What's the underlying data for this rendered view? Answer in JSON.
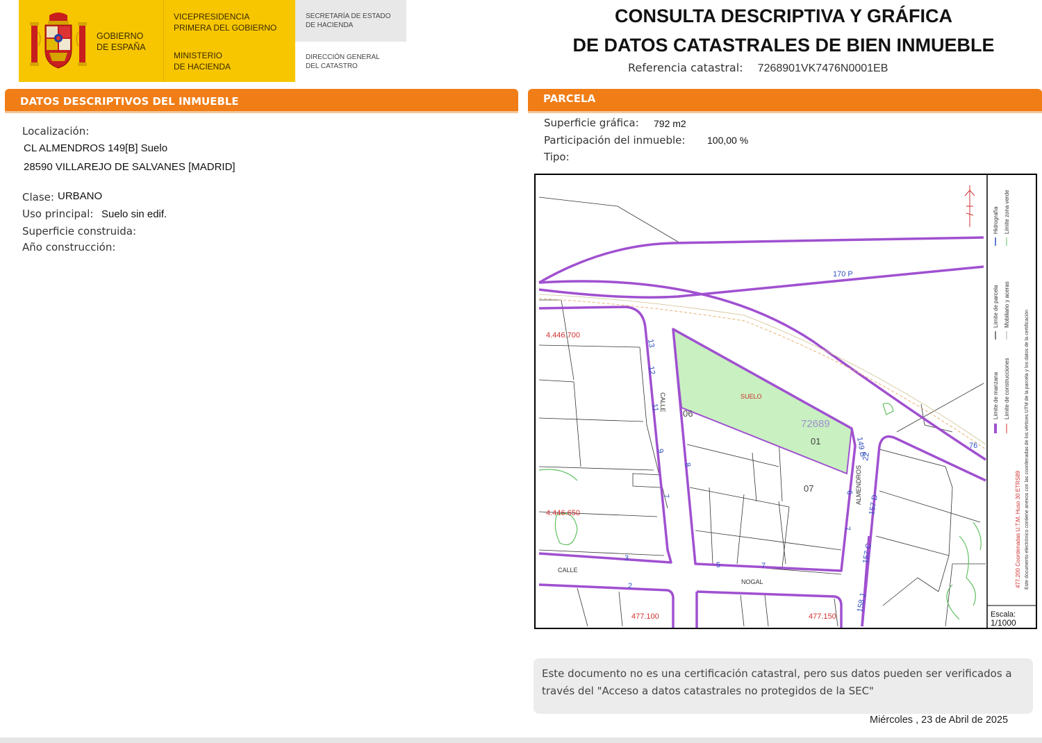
{
  "header": {
    "gov_name": [
      "GOBIERNO",
      "DE ESPAÑA"
    ],
    "vp": [
      "VICEPRESIDENCIA",
      "PRIMERA DEL GOBIERNO"
    ],
    "ministry": [
      "MINISTERIO",
      "DE HACIENDA"
    ],
    "secretaria": [
      "SECRETARÍA DE ESTADO",
      "DE HACIENDA"
    ],
    "direccion": [
      "DIRECCIÓN GENERAL",
      "DEL CATASTRO"
    ],
    "title_line1": "CONSULTA DESCRIPTIVA Y GRÁFICA",
    "title_line2": "DE DATOS CATASTRALES DE BIEN INMUEBLE",
    "ref_label": "Referencia catastral:",
    "ref_value": "7268901VK7476N0001EB"
  },
  "left": {
    "section_title": "DATOS DESCRIPTIVOS DEL INMUEBLE",
    "localizacion_label": "Localización:",
    "address_line1": "CL ALMENDROS 149[B] Suelo",
    "address_line2": "28590 VILLAREJO DE SALVANES [MADRID]",
    "clase_label": "Clase:",
    "clase_value": "URBANO",
    "uso_label": "Uso principal:",
    "uso_value": "Suelo sin edif.",
    "superficie_label": "Superficie construida:",
    "anio_label": "Año construcción:"
  },
  "right": {
    "section_title": "PARCELA",
    "sup_label": "Superficie gráfica:",
    "sup_value": "792 m2",
    "part_label": "Participación del inmueble:",
    "part_value": "100,00 %",
    "tipo_label": "Tipo:"
  },
  "map": {
    "coord_4446700": "4.446.700",
    "coord_4446650": "4.446.650",
    "coord_477100": "477.100",
    "coord_477150": "477.150",
    "road_170p": "170 P",
    "suelo": "SUELO",
    "parcel_ref": "72689",
    "p01": "01",
    "p06": "06",
    "p07": "07",
    "calle_left": "CALLE",
    "calle_bottom": "CALLE",
    "nogal": "NOGAL",
    "almendros": "ALMENDROS",
    "n149b": "149 B",
    "n157d": "157 D",
    "n157c": "157 C",
    "n158j": "158 J",
    "n22": "22",
    "n13": "13",
    "n12": "12",
    "n11": "11",
    "n9": "9",
    "n7": "7",
    "n8": "8",
    "n6": "6",
    "n3": "3",
    "n2": "2",
    "n5": "5",
    "n7b": "7",
    "n76": "76",
    "escala_label": "Escala:",
    "escala_value": "1/1000",
    "legend_1": "Límite de manzana",
    "legend_2": "Límite de parcela",
    "legend_3": "Hidrografía",
    "legend_4": "Límite de construcciones",
    "legend_5": "Mobiliario y aceras",
    "legend_6": "Límite zona verde",
    "legend_utm": "477.200 Coordenadas U.T.M. Huso 30 ETRS89",
    "legend_doc": "Este documento electrónico contiene anexos con las coordenadas de los vértices UTM de la parcela y los datos de la certificación"
  },
  "footer": {
    "notice_line1": "Este documento no es una certificación catastral, pero sus datos pueden ser verificados a",
    "notice_line2": "través del \"Acceso a datos catastrales no protegidos de la SEC\"",
    "date": "Miércoles , 23 de Abril de 2025"
  },
  "colors": {
    "orange": "#f07d16",
    "gov_yellow": "#f7c600",
    "parcel_fill": "#c8f0c0",
    "block_line": "#a050d0"
  }
}
